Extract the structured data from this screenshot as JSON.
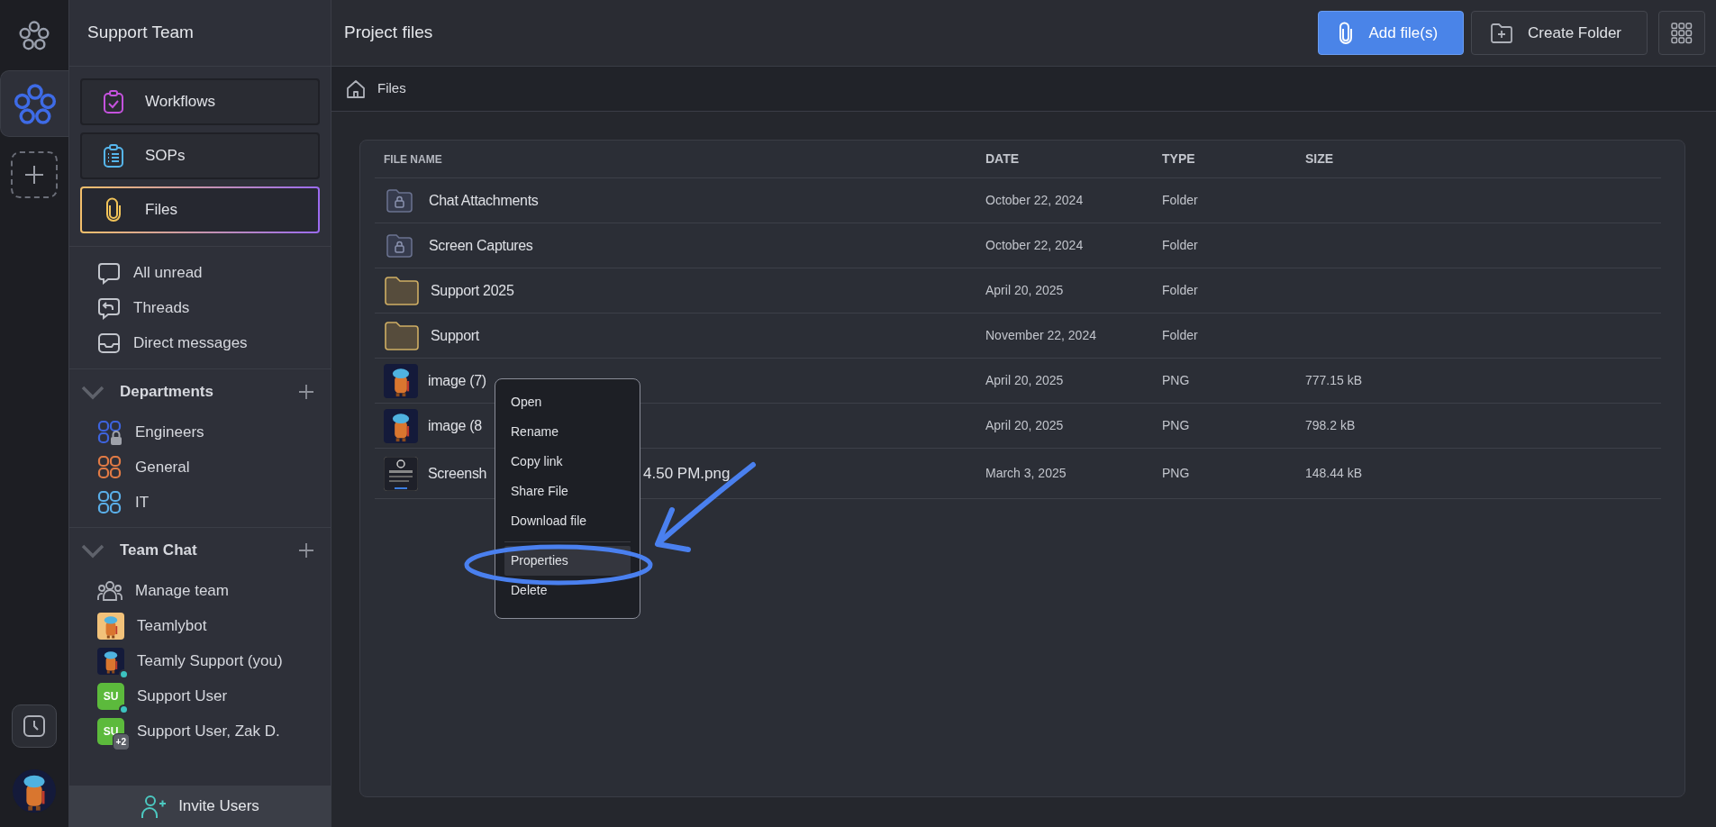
{
  "rail": {
    "workspaces": [
      {
        "selected": true
      }
    ]
  },
  "sidebar": {
    "title": "Support Team",
    "tools": [
      {
        "label": "Workflows",
        "selected": false
      },
      {
        "label": "SOPs",
        "selected": false
      },
      {
        "label": "Files",
        "selected": true
      }
    ],
    "shortcuts": [
      {
        "label": "All unread"
      },
      {
        "label": "Threads"
      },
      {
        "label": "Direct messages"
      }
    ],
    "sections": [
      {
        "title": "Departments",
        "expanded": true,
        "items": [
          {
            "kind": "channel",
            "label": "Engineers",
            "color": "#3d63dd",
            "locked": true
          },
          {
            "kind": "channel",
            "label": "General",
            "color": "#e07a45",
            "locked": false
          },
          {
            "kind": "channel",
            "label": "IT",
            "color": "#5aaee8",
            "locked": false
          }
        ]
      },
      {
        "title": "Team Chat",
        "expanded": true,
        "items": [
          {
            "kind": "action",
            "label": "Manage team"
          },
          {
            "kind": "avatar",
            "label": "Teamlybot",
            "online": false
          },
          {
            "kind": "avatar",
            "label": "Teamly Support (you)",
            "online": true
          },
          {
            "kind": "initials",
            "initials": "SU",
            "label": "Support User",
            "online": true
          },
          {
            "kind": "initials",
            "initials": "SU",
            "label": "Support User, Zak D.",
            "online": false,
            "extra": "+2"
          }
        ]
      }
    ],
    "invite_button": "Invite Users"
  },
  "header": {
    "title": "Project files",
    "buttons": [
      {
        "label": "Add file(s)",
        "kind": "primary"
      },
      {
        "label": "Create Folder",
        "kind": "secondary"
      }
    ]
  },
  "breadcrumb": [
    "Files"
  ],
  "table": {
    "columns": [
      "FILE NAME",
      "DATE",
      "TYPE",
      "SIZE"
    ],
    "rows": [
      {
        "kind": "locked-folder",
        "name": "Chat Attachments",
        "date": "October 22, 2024",
        "type": "Folder"
      },
      {
        "kind": "locked-folder",
        "name": "Screen Captures",
        "date": "October 22, 2024",
        "type": "Folder"
      },
      {
        "kind": "folder",
        "name": "Support 2025",
        "date": "April 20, 2025",
        "type": "Folder"
      },
      {
        "kind": "folder",
        "name": "Support",
        "date": "November 22, 2024",
        "type": "Folder"
      },
      {
        "name": "image (7)",
        "date": "April 20, 2025",
        "type": "PNG",
        "size": "777.15 kB"
      },
      {
        "name": "image (8",
        "date": "April 20, 2025",
        "type": "PNG",
        "size": "798.2 kB"
      },
      {
        "name": "Screensh",
        "name_tail": "4.50 PM.png",
        "date": "March 3, 2025",
        "type": "PNG",
        "size": "148.44 kB"
      }
    ]
  },
  "context_menu": {
    "items": [
      {
        "label": "Open",
        "selected": false,
        "divider_before": false
      },
      {
        "label": "Rename",
        "selected": false,
        "divider_before": false
      },
      {
        "label": "Copy link",
        "selected": false,
        "divider_before": false
      },
      {
        "label": "Share File",
        "selected": false,
        "divider_before": false
      },
      {
        "label": "Download file",
        "selected": false,
        "divider_before": false
      },
      {
        "label": "Properties",
        "selected": true,
        "divider_before": true
      },
      {
        "label": "Delete",
        "selected": false,
        "divider_before": false
      }
    ]
  }
}
